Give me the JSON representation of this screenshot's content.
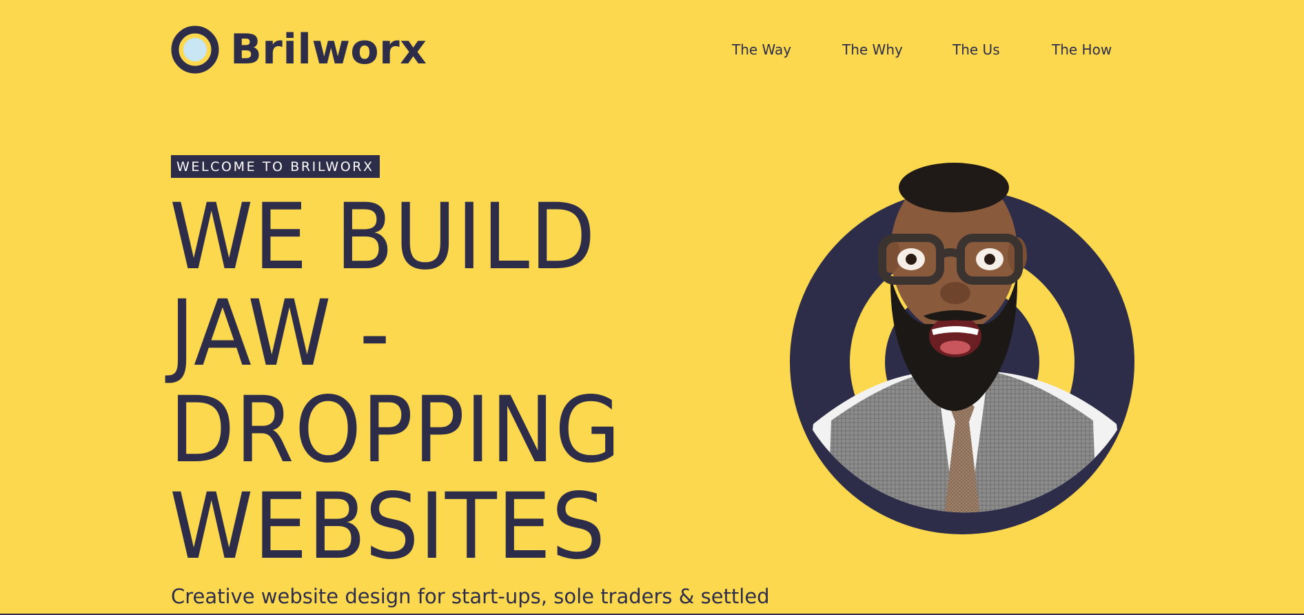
{
  "header": {
    "logo_text": "Brilworx",
    "nav": [
      {
        "label": "The Way"
      },
      {
        "label": "The Why"
      },
      {
        "label": "The Us"
      },
      {
        "label": "The How"
      }
    ]
  },
  "hero": {
    "badge": "WELCOME TO BRILWORX",
    "headline_lines": [
      "WE BUILD",
      "JAW -",
      "DROPPING",
      "WEBSITES"
    ],
    "subheadline": "Creative website design for start-ups, sole traders & settled",
    "image_alt": "Surprised bearded man wearing glasses, shirt, tie and vest",
    "image_icon": "portrait-photo"
  },
  "colors": {
    "background": "#fcd84f",
    "navy": "#2d2d4a",
    "logo_dot": "#c9e6f5",
    "white": "#ffffff"
  }
}
